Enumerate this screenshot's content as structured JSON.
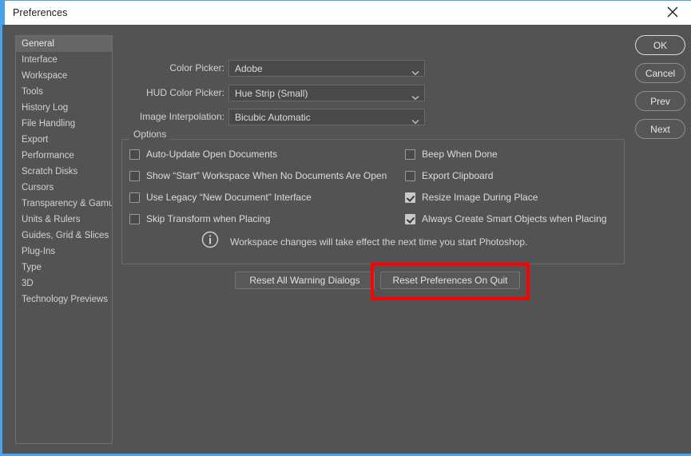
{
  "window": {
    "title": "Preferences",
    "close_icon": "close-icon",
    "accent_color": "#4aa3e8",
    "background_color": "#535353"
  },
  "sidebar": {
    "items": [
      {
        "label": "General",
        "active": true
      },
      {
        "label": "Interface",
        "active": false
      },
      {
        "label": "Workspace",
        "active": false
      },
      {
        "label": "Tools",
        "active": false
      },
      {
        "label": "History Log",
        "active": false
      },
      {
        "label": "File Handling",
        "active": false
      },
      {
        "label": "Export",
        "active": false
      },
      {
        "label": "Performance",
        "active": false
      },
      {
        "label": "Scratch Disks",
        "active": false
      },
      {
        "label": "Cursors",
        "active": false
      },
      {
        "label": "Transparency & Gamut",
        "active": false
      },
      {
        "label": "Units & Rulers",
        "active": false
      },
      {
        "label": "Guides, Grid & Slices",
        "active": false
      },
      {
        "label": "Plug-Ins",
        "active": false
      },
      {
        "label": "Type",
        "active": false
      },
      {
        "label": "3D",
        "active": false
      },
      {
        "label": "Technology Previews",
        "active": false
      }
    ]
  },
  "fields": [
    {
      "label": "Color Picker:",
      "value": "Adobe",
      "icon": "chevron-down-icon"
    },
    {
      "label": "HUD Color Picker:",
      "value": "Hue Strip (Small)",
      "icon": "chevron-down-icon"
    },
    {
      "label": "Image Interpolation:",
      "value": "Bicubic Automatic",
      "icon": "chevron-down-icon"
    }
  ],
  "options": {
    "group_title": "Options",
    "left_column": [
      {
        "label": "Auto-Update Open Documents",
        "checked": false
      },
      {
        "label": "Show “Start” Workspace When No Documents Are Open",
        "checked": false
      },
      {
        "label": "Use Legacy “New Document” Interface",
        "checked": false
      },
      {
        "label": "Skip Transform when Placing",
        "checked": false
      }
    ],
    "right_column": [
      {
        "label": "Beep When Done",
        "checked": false
      },
      {
        "label": "Export Clipboard",
        "checked": false
      },
      {
        "label": "Resize Image During Place",
        "checked": true
      },
      {
        "label": "Always Create Smart Objects when Placing",
        "checked": true
      }
    ],
    "note": {
      "icon": "info-icon",
      "text": "Workspace changes will take effect the next time you start Photoshop."
    }
  },
  "reset_buttons": {
    "reset_warnings": "Reset All Warning Dialogs",
    "reset_on_quit": "Reset Preferences On Quit"
  },
  "highlight": {
    "color": "#ff0000",
    "target": "Reset Preferences On Quit"
  },
  "actions": [
    {
      "label": "OK",
      "primary": true
    },
    {
      "label": "Cancel",
      "primary": false
    },
    {
      "label": "Prev",
      "primary": false
    },
    {
      "label": "Next",
      "primary": false
    }
  ]
}
